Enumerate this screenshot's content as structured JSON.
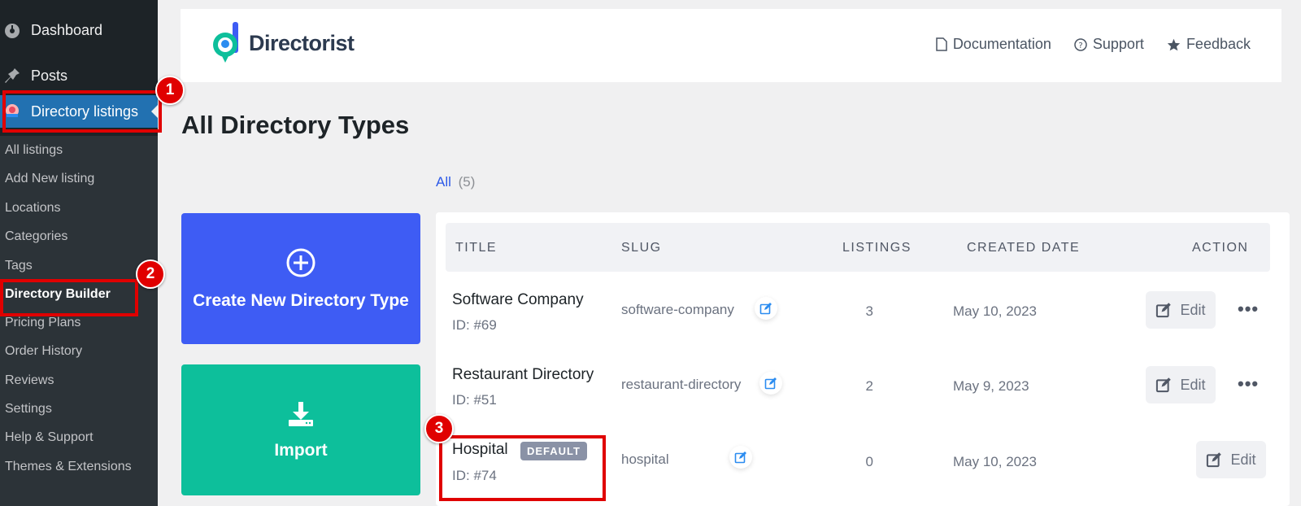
{
  "sidebar": {
    "top_items": [
      {
        "label": "Dashboard",
        "icon": "dashboard-icon"
      },
      {
        "label": "Posts",
        "icon": "pin-icon"
      },
      {
        "label": "Directory listings",
        "icon": "directorist-icon"
      }
    ],
    "sub_items": [
      {
        "label": "All listings"
      },
      {
        "label": "Add New listing"
      },
      {
        "label": "Locations"
      },
      {
        "label": "Categories"
      },
      {
        "label": "Tags"
      },
      {
        "label": "Directory Builder"
      },
      {
        "label": "Pricing Plans"
      },
      {
        "label": "Order History"
      },
      {
        "label": "Reviews"
      },
      {
        "label": "Settings"
      },
      {
        "label": "Help & Support"
      },
      {
        "label": "Themes & Extensions"
      }
    ]
  },
  "header": {
    "brand": "Directorist",
    "links": [
      {
        "label": "Documentation",
        "icon": "document-icon"
      },
      {
        "label": "Support",
        "icon": "help-icon"
      },
      {
        "label": "Feedback",
        "icon": "star-icon"
      }
    ]
  },
  "page": {
    "title": "All Directory Types"
  },
  "cards": {
    "create_label": "Create New Directory Type",
    "import_label": "Import"
  },
  "filter": {
    "all_label": "All",
    "all_count": "(5)"
  },
  "table": {
    "columns": {
      "title": "TITLE",
      "slug": "SLUG",
      "listings": "LISTINGS",
      "created": "CREATED DATE",
      "action": "ACTION"
    },
    "rows": [
      {
        "title": "Software Company",
        "id": "ID: #69",
        "slug": "software-company",
        "listings": "3",
        "date": "May 10, 2023",
        "edit": "Edit",
        "more": "•••"
      },
      {
        "title": "Restaurant Directory",
        "id": "ID: #51",
        "slug": "restaurant-directory",
        "listings": "2",
        "date": "May 9, 2023",
        "edit": "Edit",
        "more": "•••"
      },
      {
        "title": "Hospital",
        "id": "ID: #74",
        "slug": "hospital",
        "listings": "0",
        "date": "May 10, 2023",
        "edit": "Edit",
        "badge": "DEFAULT"
      }
    ]
  },
  "annotations": [
    "1",
    "2",
    "3"
  ],
  "colors": {
    "accent_blue": "#3e5cf4",
    "accent_green": "#0dbf9b",
    "wp_blue": "#2271b1",
    "annotation_red": "#e00000"
  }
}
